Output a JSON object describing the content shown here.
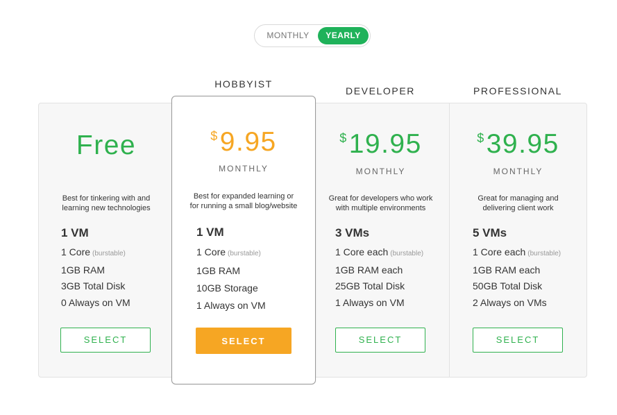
{
  "billing_toggle": {
    "monthly_label": "MONTHLY",
    "yearly_label": "YEARLY",
    "selected": "YEARLY"
  },
  "colors": {
    "accent_green": "#2fb14e",
    "accent_orange": "#f6a623",
    "toggle_green": "#1fb25a"
  },
  "plans": [
    {
      "name": "",
      "price": "Free",
      "currency": "",
      "period": "",
      "description_line1": "Best for tinkering with and",
      "description_line2": "learning new technologies",
      "features_head": "1 VM",
      "features": [
        {
          "text": "1 Core",
          "note": "(burstable)"
        },
        {
          "text": "1GB RAM",
          "note": ""
        },
        {
          "text": "3GB Total Disk",
          "note": ""
        },
        {
          "text": "0 Always on VM",
          "note": ""
        }
      ],
      "button": "SELECT"
    },
    {
      "name": "HOBBYIST",
      "price": "9.95",
      "currency": "$",
      "period": "MONTHLY",
      "description_line1": "Best for expanded learning or",
      "description_line2": "for running a small blog/website",
      "features_head": "1 VM",
      "features": [
        {
          "text": "1 Core",
          "note": "(burstable)"
        },
        {
          "text": "1GB RAM",
          "note": ""
        },
        {
          "text": "10GB Storage",
          "note": ""
        },
        {
          "text": "1 Always on VM",
          "note": ""
        }
      ],
      "button": "SELECT"
    },
    {
      "name": "DEVELOPER",
      "price": "19.95",
      "currency": "$",
      "period": "MONTHLY",
      "description_line1": "Great for developers who work",
      "description_line2": "with multiple environments",
      "features_head": "3 VMs",
      "features": [
        {
          "text": "1 Core each",
          "note": "(burstable)"
        },
        {
          "text": "1GB RAM each",
          "note": ""
        },
        {
          "text": "25GB Total Disk",
          "note": ""
        },
        {
          "text": "1 Always on VM",
          "note": ""
        }
      ],
      "button": "SELECT"
    },
    {
      "name": "PROFESSIONAL",
      "price": "39.95",
      "currency": "$",
      "period": "MONTHLY",
      "description_line1": "Great for managing and",
      "description_line2": "delivering client work",
      "features_head": "5 VMs",
      "features": [
        {
          "text": "1 Core each",
          "note": "(burstable)"
        },
        {
          "text": "1GB RAM each",
          "note": ""
        },
        {
          "text": "50GB Total Disk",
          "note": ""
        },
        {
          "text": "2 Always on VMs",
          "note": ""
        }
      ],
      "button": "SELECT"
    }
  ]
}
